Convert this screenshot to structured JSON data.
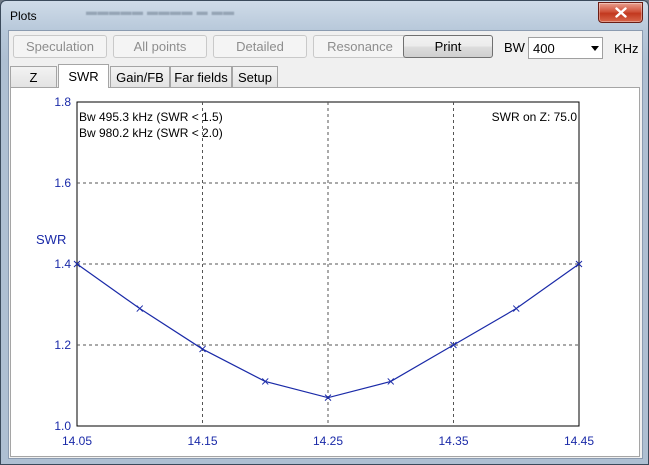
{
  "window": {
    "title": "Plots",
    "close_icon": "close-icon"
  },
  "toolbar": {
    "buttons": [
      {
        "label": "Speculation",
        "enabled": false
      },
      {
        "label": "All points",
        "enabled": false
      },
      {
        "label": "Detailed",
        "enabled": false
      },
      {
        "label": "Resonance",
        "enabled": false
      },
      {
        "label": "Print",
        "enabled": true
      }
    ],
    "bw_label": "BW",
    "bw_value": "400",
    "bw_unit": "KHz"
  },
  "tabs": [
    {
      "label": "Z",
      "active": false
    },
    {
      "label": "SWR",
      "active": true
    },
    {
      "label": "Gain/FB",
      "active": false
    },
    {
      "label": "Far fields",
      "active": false
    },
    {
      "label": "Setup",
      "active": false
    }
  ],
  "plot": {
    "info_left": [
      "Bw 495.3 kHz (SWR < 1.5)",
      "Bw 980.2 kHz (SWR < 2.0)"
    ],
    "info_right": "SWR on Z: 75.0"
  },
  "chart_data": {
    "type": "line",
    "title": "",
    "xlabel": "",
    "ylabel": "SWR",
    "xlim": [
      14.05,
      14.45
    ],
    "ylim": [
      1.0,
      1.8
    ],
    "x_ticks": [
      "14.05",
      "14.15",
      "14.25",
      "14.35",
      "14.45"
    ],
    "y_ticks": [
      "1.0",
      "1.2",
      "1.4",
      "1.6",
      "1.8"
    ],
    "grid": true,
    "grid_style": "dashed",
    "line_color": "#1a2aa8",
    "marker": "x",
    "series": [
      {
        "x": [
          14.05,
          14.1,
          14.15,
          14.2,
          14.25,
          14.3,
          14.35,
          14.4,
          14.45
        ],
        "y": [
          1.4,
          1.29,
          1.19,
          1.11,
          1.07,
          1.11,
          1.2,
          1.29,
          1.4
        ]
      }
    ]
  }
}
